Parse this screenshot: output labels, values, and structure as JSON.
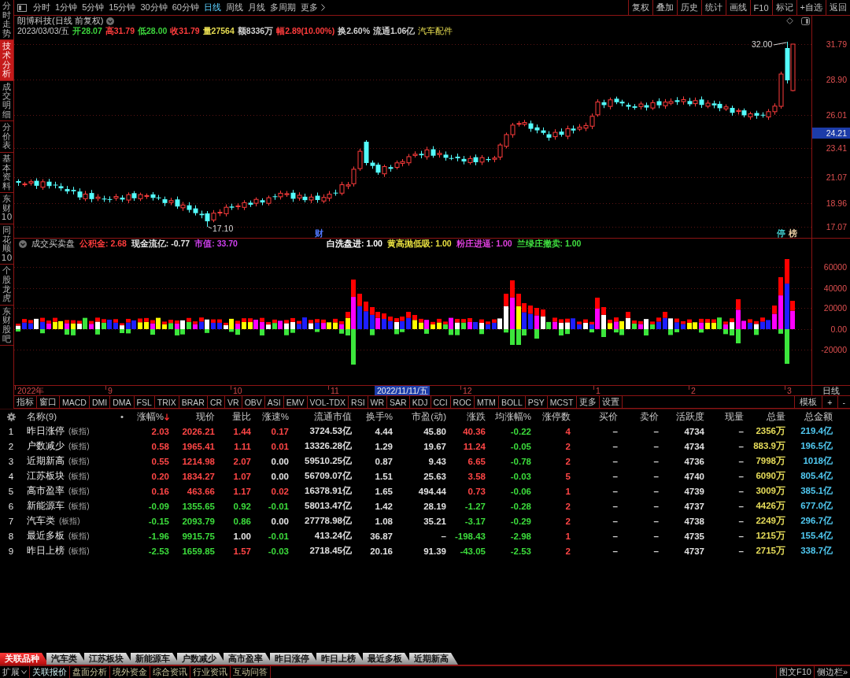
{
  "side_tabs": [
    {
      "label": "分时走势",
      "selected": false
    },
    {
      "label": "技术分析",
      "selected": true
    },
    {
      "label": "成交明细",
      "selected": false
    },
    {
      "label": "分价表",
      "selected": false
    },
    {
      "label": "基本资料",
      "selected": false
    },
    {
      "label": "东财10",
      "selected": false
    },
    {
      "label": "同花顺10",
      "selected": false
    },
    {
      "label": "个股龙虎",
      "selected": false
    },
    {
      "label": "东财股吧",
      "selected": false
    }
  ],
  "toolbar": {
    "periods": [
      {
        "label": "分时",
        "selected": false
      },
      {
        "label": "1分钟",
        "selected": false
      },
      {
        "label": "5分钟",
        "selected": false
      },
      {
        "label": "15分钟",
        "selected": false
      },
      {
        "label": "30分钟",
        "selected": false
      },
      {
        "label": "60分钟",
        "selected": false
      },
      {
        "label": "日线",
        "selected": true
      },
      {
        "label": "周线",
        "selected": false
      },
      {
        "label": "月线",
        "selected": false
      },
      {
        "label": "多周期",
        "selected": false
      }
    ],
    "more": {
      "label": "更多",
      "selected": false
    },
    "actions": [
      "复权",
      "叠加",
      "历史",
      "统计",
      "画线",
      "F10",
      "标记",
      "+自选",
      "返回"
    ]
  },
  "price_chart": {
    "title": "朗博科技(日线 前复权)",
    "date": "2023/03/03/五",
    "quote": [
      {
        "label": "开",
        "value": "28.07",
        "color": "#3cd23c"
      },
      {
        "label": "高",
        "value": "31.79",
        "color": "#ff3c3c"
      },
      {
        "label": "低",
        "value": "28.00",
        "color": "#3cd23c"
      },
      {
        "label": "收",
        "value": "31.79",
        "color": "#ff3c3c"
      },
      {
        "label": "量",
        "value": "27564",
        "color": "#e6dc50"
      },
      {
        "label": "额",
        "value": "8336万",
        "color": "#d2d2d2"
      },
      {
        "label": "幅",
        "value": "2.89(10.00%)",
        "color": "#ff3c3c"
      },
      {
        "label": "换",
        "value": "2.60%",
        "color": "#d2d2d2"
      },
      {
        "label": "流通",
        "value": "1.06亿",
        "color": "#d2d2d2"
      }
    ],
    "sector": "汽车配件",
    "high_label": "32.00",
    "low_label": "17.10",
    "event_markers": [
      {
        "text": "财",
        "color": "#5078ff"
      },
      {
        "text": "停",
        "color": "#40c8c8"
      },
      {
        "text": "榜",
        "color": "#e6caa0"
      }
    ],
    "price_axis": [
      "31.79",
      "28.90",
      "26.01",
      "23.41",
      "21.07",
      "18.96",
      "17.07"
    ],
    "cursor_price": "24.21"
  },
  "indicator": {
    "name": "成交买卖盘",
    "values": [
      {
        "label": "公积金:",
        "value": "2.68",
        "color": "#ff3c3c"
      },
      {
        "label": "现金流亿:",
        "value": "-0.77",
        "color": "#e6e6e6"
      },
      {
        "label": "市值:",
        "value": "33.70",
        "color": "#d040f0"
      }
    ],
    "signals": [
      {
        "label": "白洗盘进:",
        "value": "1.00",
        "color": "#ffffff"
      },
      {
        "label": "黄高抛低吸:",
        "value": "1.00",
        "color": "#e8e040"
      },
      {
        "label": "粉庄进逼:",
        "value": "1.00",
        "color": "#e040e0"
      },
      {
        "label": "兰绿庄撤卖:",
        "value": "1.00",
        "color": "#40e040"
      }
    ],
    "axis": [
      "60000",
      "40000",
      "20000",
      "0.00",
      "-20000"
    ]
  },
  "time_axis": {
    "labels": [
      "2022年",
      "9",
      "10",
      "11",
      "12",
      "1",
      "2",
      "3"
    ],
    "cursor_date": "2022/11/11/五",
    "period": "日线"
  },
  "indicator_tabs": [
    "指标",
    "窗口",
    "MACD",
    "DMI",
    "DMA",
    "FSL",
    "TRIX",
    "BRAR",
    "CR",
    "VR",
    "OBV",
    "ASI",
    "EMV",
    "VOL-TDX",
    "RSI",
    "WR",
    "SAR",
    "KDJ",
    "CCI",
    "ROC",
    "MTM",
    "BOLL",
    "PSY",
    "MCST",
    "更多",
    "设置"
  ],
  "template_controls": [
    "模板",
    "+",
    "-"
  ],
  "table": {
    "columns": [
      {
        "kind": "index",
        "sorted": false
      },
      {
        "kind": "name",
        "label": "名称(9)",
        "marker": "•",
        "sorted": false
      },
      {
        "kind": "trend",
        "label": "涨幅%",
        "sorted": true
      },
      {
        "kind": "trend",
        "label": "现价",
        "sorted": false
      },
      {
        "kind": "trend",
        "label": "量比",
        "sorted": false
      },
      {
        "kind": "trend",
        "label": "涨速%",
        "sorted": false
      },
      {
        "kind": "plain",
        "label": "流通市值",
        "sorted": false
      },
      {
        "kind": "plain",
        "label": "换手%",
        "sorted": false
      },
      {
        "kind": "plain",
        "label": "市盈(动)",
        "sorted": false
      },
      {
        "kind": "trend",
        "label": "涨跌",
        "sorted": false
      },
      {
        "kind": "trend",
        "label": "均涨幅%",
        "sorted": false
      },
      {
        "kind": "count",
        "label": "涨停数",
        "sorted": false
      },
      {
        "kind": "plain",
        "label": "买价",
        "sorted": false
      },
      {
        "kind": "plain",
        "label": "卖价",
        "sorted": false
      },
      {
        "kind": "plain",
        "label": "活跃度",
        "sorted": false
      },
      {
        "kind": "plain",
        "label": "现量",
        "sorted": false
      },
      {
        "kind": "volume",
        "label": "总量",
        "sorted": false
      },
      {
        "kind": "amount",
        "label": "总金额",
        "sorted": false
      }
    ],
    "rows": [
      {
        "cells": [
          {
            "text": "1"
          },
          {
            "text": "昨日涨停",
            "tag": "(板指)"
          },
          {
            "text": "2.03",
            "color": "#ff4646"
          },
          {
            "text": "2026.21",
            "color": "#ff4646"
          },
          {
            "text": "1.44",
            "color": "#ff4646"
          },
          {
            "text": "0.17",
            "color": "#ff4646"
          },
          {
            "text": "3724.53亿"
          },
          {
            "text": "4.44"
          },
          {
            "text": "45.80"
          },
          {
            "text": "40.36",
            "color": "#ff4646"
          },
          {
            "text": "-0.22",
            "color": "#3cdc3c"
          },
          {
            "text": "4"
          },
          {
            "text": "–"
          },
          {
            "text": "–"
          },
          {
            "text": "4734"
          },
          {
            "text": "–"
          },
          {
            "text": "2356万"
          },
          {
            "text": "219.4亿"
          }
        ]
      },
      {
        "cells": [
          {
            "text": "2"
          },
          {
            "text": "户数减少",
            "tag": "(板指)"
          },
          {
            "text": "0.58",
            "color": "#ff4646"
          },
          {
            "text": "1965.41",
            "color": "#ff4646"
          },
          {
            "text": "1.11",
            "color": "#ff4646"
          },
          {
            "text": "0.01",
            "color": "#ff4646"
          },
          {
            "text": "13326.28亿"
          },
          {
            "text": "1.29"
          },
          {
            "text": "19.67"
          },
          {
            "text": "11.24",
            "color": "#ff4646"
          },
          {
            "text": "-0.05",
            "color": "#3cdc3c"
          },
          {
            "text": "2"
          },
          {
            "text": "–"
          },
          {
            "text": "–"
          },
          {
            "text": "4734"
          },
          {
            "text": "–"
          },
          {
            "text": "883.9万"
          },
          {
            "text": "196.5亿"
          }
        ]
      },
      {
        "cells": [
          {
            "text": "3"
          },
          {
            "text": "近期新高",
            "tag": "(板指)"
          },
          {
            "text": "0.55",
            "color": "#ff4646"
          },
          {
            "text": "1214.98",
            "color": "#ff4646"
          },
          {
            "text": "2.07",
            "color": "#ff4646"
          },
          {
            "text": "0.00",
            "color": "#e6e6e6"
          },
          {
            "text": "59510.25亿"
          },
          {
            "text": "0.87"
          },
          {
            "text": "9.43"
          },
          {
            "text": "6.65",
            "color": "#ff4646"
          },
          {
            "text": "-0.78",
            "color": "#3cdc3c"
          },
          {
            "text": "2"
          },
          {
            "text": "–"
          },
          {
            "text": "–"
          },
          {
            "text": "4736"
          },
          {
            "text": "–"
          },
          {
            "text": "7998万"
          },
          {
            "text": "1018亿"
          }
        ]
      },
      {
        "cells": [
          {
            "text": "4"
          },
          {
            "text": "江苏板块",
            "tag": "(板指)"
          },
          {
            "text": "0.20",
            "color": "#ff4646"
          },
          {
            "text": "1834.27",
            "color": "#ff4646"
          },
          {
            "text": "1.07",
            "color": "#ff4646"
          },
          {
            "text": "0.00",
            "color": "#e6e6e6"
          },
          {
            "text": "56709.07亿"
          },
          {
            "text": "1.51"
          },
          {
            "text": "25.63"
          },
          {
            "text": "3.58",
            "color": "#ff4646"
          },
          {
            "text": "-0.03",
            "color": "#3cdc3c"
          },
          {
            "text": "5"
          },
          {
            "text": "–"
          },
          {
            "text": "–"
          },
          {
            "text": "4740"
          },
          {
            "text": "–"
          },
          {
            "text": "6090万"
          },
          {
            "text": "805.4亿"
          }
        ]
      },
      {
        "cells": [
          {
            "text": "5"
          },
          {
            "text": "高市盈率",
            "tag": "(板指)"
          },
          {
            "text": "0.16",
            "color": "#ff4646"
          },
          {
            "text": "463.66",
            "color": "#ff4646"
          },
          {
            "text": "1.17",
            "color": "#ff4646"
          },
          {
            "text": "0.02",
            "color": "#ff4646"
          },
          {
            "text": "16378.91亿"
          },
          {
            "text": "1.65"
          },
          {
            "text": "494.44"
          },
          {
            "text": "0.73",
            "color": "#ff4646"
          },
          {
            "text": "-0.06",
            "color": "#3cdc3c"
          },
          {
            "text": "1"
          },
          {
            "text": "–"
          },
          {
            "text": "–"
          },
          {
            "text": "4739"
          },
          {
            "text": "–"
          },
          {
            "text": "3009万"
          },
          {
            "text": "385.1亿"
          }
        ]
      },
      {
        "cells": [
          {
            "text": "6"
          },
          {
            "text": "新能源车",
            "tag": "(板指)"
          },
          {
            "text": "-0.09",
            "color": "#3cdc3c"
          },
          {
            "text": "1355.65",
            "color": "#3cdc3c"
          },
          {
            "text": "0.92",
            "color": "#3cdc3c"
          },
          {
            "text": "-0.01",
            "color": "#3cdc3c"
          },
          {
            "text": "58013.47亿"
          },
          {
            "text": "1.42"
          },
          {
            "text": "28.19"
          },
          {
            "text": "-1.27",
            "color": "#3cdc3c"
          },
          {
            "text": "-0.28",
            "color": "#3cdc3c"
          },
          {
            "text": "2"
          },
          {
            "text": "–"
          },
          {
            "text": "–"
          },
          {
            "text": "4737"
          },
          {
            "text": "–"
          },
          {
            "text": "4426万"
          },
          {
            "text": "677.0亿"
          }
        ]
      },
      {
        "cells": [
          {
            "text": "7"
          },
          {
            "text": "汽车类",
            "tag": "(板指)"
          },
          {
            "text": "-0.15",
            "color": "#3cdc3c"
          },
          {
            "text": "2093.79",
            "color": "#3cdc3c"
          },
          {
            "text": "0.86",
            "color": "#3cdc3c"
          },
          {
            "text": "0.00",
            "color": "#e6e6e6"
          },
          {
            "text": "27778.98亿"
          },
          {
            "text": "1.08"
          },
          {
            "text": "35.21"
          },
          {
            "text": "-3.17",
            "color": "#3cdc3c"
          },
          {
            "text": "-0.29",
            "color": "#3cdc3c"
          },
          {
            "text": "2"
          },
          {
            "text": "–"
          },
          {
            "text": "–"
          },
          {
            "text": "4738"
          },
          {
            "text": "–"
          },
          {
            "text": "2249万"
          },
          {
            "text": "296.7亿"
          }
        ]
      },
      {
        "cells": [
          {
            "text": "8"
          },
          {
            "text": "最近多板",
            "tag": "(板指)"
          },
          {
            "text": "-1.96",
            "color": "#3cdc3c"
          },
          {
            "text": "9915.75",
            "color": "#3cdc3c"
          },
          {
            "text": "1.00",
            "color": "#e6e6e6"
          },
          {
            "text": "-0.01",
            "color": "#3cdc3c"
          },
          {
            "text": "413.24亿"
          },
          {
            "text": "36.87"
          },
          {
            "text": "–"
          },
          {
            "text": "-198.43",
            "color": "#3cdc3c"
          },
          {
            "text": "-2.98",
            "color": "#3cdc3c"
          },
          {
            "text": "1"
          },
          {
            "text": "–"
          },
          {
            "text": "–"
          },
          {
            "text": "4735"
          },
          {
            "text": "–"
          },
          {
            "text": "1215万"
          },
          {
            "text": "155.4亿"
          }
        ]
      },
      {
        "cells": [
          {
            "text": "9"
          },
          {
            "text": "昨日上榜",
            "tag": "(板指)"
          },
          {
            "text": "-2.53",
            "color": "#3cdc3c"
          },
          {
            "text": "1659.85",
            "color": "#3cdc3c"
          },
          {
            "text": "1.57",
            "color": "#ff4646"
          },
          {
            "text": "-0.03",
            "color": "#3cdc3c"
          },
          {
            "text": "2718.45亿"
          },
          {
            "text": "20.16"
          },
          {
            "text": "91.39"
          },
          {
            "text": "-43.05",
            "color": "#3cdc3c"
          },
          {
            "text": "-2.53",
            "color": "#3cdc3c"
          },
          {
            "text": "2"
          },
          {
            "text": "–"
          },
          {
            "text": "–"
          },
          {
            "text": "4737"
          },
          {
            "text": "–"
          },
          {
            "text": "2715万"
          },
          {
            "text": "338.7亿"
          }
        ]
      }
    ]
  },
  "sector_tabs": [
    {
      "label": "关联品种",
      "selected": true
    },
    {
      "label": "汽车类",
      "selected": false
    },
    {
      "label": "江苏板块",
      "selected": false
    },
    {
      "label": "新能源车",
      "selected": false
    },
    {
      "label": "户数减少",
      "selected": false
    },
    {
      "label": "高市盈率",
      "selected": false
    },
    {
      "label": "昨日涨停",
      "selected": false
    },
    {
      "label": "昨日上榜",
      "selected": false
    },
    {
      "label": "最近多板",
      "selected": false
    },
    {
      "label": "近期新高",
      "selected": false
    }
  ],
  "status_bar": {
    "expand": {
      "label": "扩展"
    },
    "items": [
      {
        "label": "关联报价",
        "selected": true
      },
      {
        "label": "盘面分析",
        "selected": false
      },
      {
        "label": "境外资金",
        "selected": false
      },
      {
        "label": "综合资讯",
        "selected": false
      },
      {
        "label": "行业资讯",
        "selected": false
      },
      {
        "label": "互动问答",
        "selected": false
      }
    ],
    "right": [
      "图文F10",
      "侧边栏»"
    ]
  }
}
